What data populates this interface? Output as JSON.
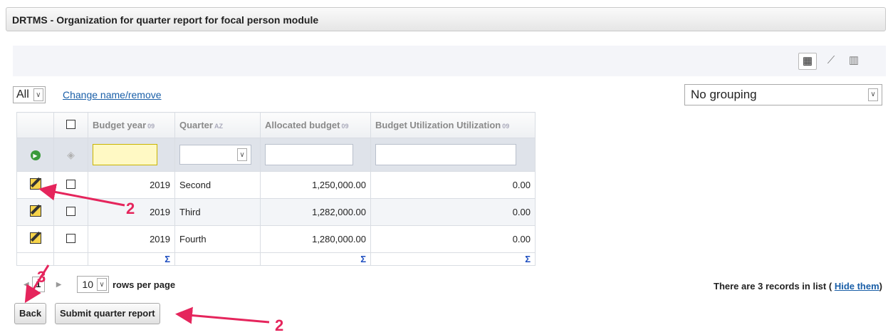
{
  "window": {
    "title": "DRTMS - Organization for quarter report for focal person module"
  },
  "view_buttons": [
    {
      "icon": "grid-view-icon",
      "glyph": "▦"
    },
    {
      "icon": "chart-view-icon",
      "glyph": "⟋"
    },
    {
      "icon": "column-view-icon",
      "glyph": "▥"
    }
  ],
  "filter": {
    "selected": "All",
    "change_link": "Change name/remove"
  },
  "grouping": {
    "selected": "No grouping"
  },
  "table": {
    "headers": [
      "Budget year",
      "Quarter",
      "Allocated budget",
      "Budget Utilization Utilization"
    ],
    "rows": [
      {
        "year": "2019",
        "quarter": "Second",
        "allocated": "1,250,000.00",
        "utilization": "0.00"
      },
      {
        "year": "2019",
        "quarter": "Third",
        "allocated": "1,282,000.00",
        "utilization": "0.00"
      },
      {
        "year": "2019",
        "quarter": "Fourth",
        "allocated": "1,280,000.00",
        "utilization": "0.00"
      }
    ],
    "sum_symbol": "Σ"
  },
  "pager": {
    "page": "1",
    "rows_per_page": "10",
    "rows_per_page_label": "rows per page"
  },
  "records": {
    "text": "There are 3 records in list (",
    "hide_link": "Hide them",
    "close": ")"
  },
  "buttons": {
    "back": "Back",
    "submit": "Submit quarter report"
  },
  "annotations": {
    "marker_a": "2",
    "marker_b": "3",
    "marker_c": "2"
  },
  "colors": {
    "annotation": "#e5255c",
    "link": "#1a5fa8",
    "sigma": "#1f4fc0"
  }
}
